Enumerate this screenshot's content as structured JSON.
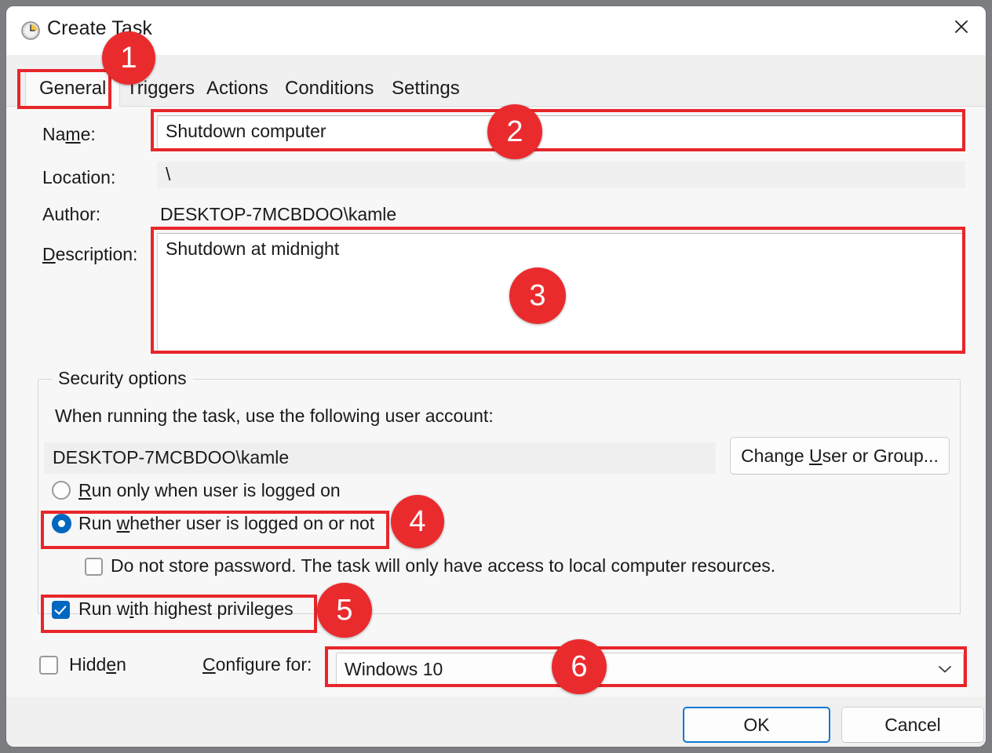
{
  "window": {
    "title": "Create Task",
    "app_icon": "clock-schedule-icon",
    "close_label": "✕"
  },
  "tabs": [
    {
      "label": "General",
      "active": true
    },
    {
      "label": "Triggers",
      "active": false
    },
    {
      "label": "Actions",
      "active": false
    },
    {
      "label": "Conditions",
      "active": false
    },
    {
      "label": "Settings",
      "active": false
    }
  ],
  "general": {
    "name_label_pre": "Na",
    "name_label_key": "m",
    "name_label_post": "e:",
    "name_value": "Shutdown computer",
    "location_label": "Location:",
    "location_value": "\\",
    "author_label": "Author:",
    "author_value": "DESKTOP-7MCBDOO\\kamle",
    "description_label_key": "D",
    "description_label_post": "escription:",
    "description_value": "Shutdown at midnight"
  },
  "security": {
    "legend": "Security options",
    "account_prompt": "When running the task, use the following user account:",
    "account_value": "DESKTOP-7MCBDOO\\kamle",
    "change_user_pre": "Change ",
    "change_user_key": "U",
    "change_user_post": "ser or Group...",
    "radio_logged_on": {
      "key": "R",
      "post": "un only when user is logged on",
      "checked": false
    },
    "radio_whether": {
      "pre": "Run ",
      "key": "w",
      "post": "hether user is logged on or not",
      "checked": true
    },
    "checkbox_no_password": {
      "label": "Do not store password.  The task will only have access to local computer resources.",
      "checked": false
    },
    "checkbox_highest": {
      "pre": "Run w",
      "key": "i",
      "post": "th highest privileges",
      "checked": true
    }
  },
  "bottom": {
    "hidden_pre": "Hidd",
    "hidden_key": "e",
    "hidden_post": "n",
    "hidden_checked": false,
    "configure_key": "C",
    "configure_post": "onfigure for:",
    "configure_value": "Windows 10",
    "configure_arrow": "chevron-down-icon"
  },
  "footer": {
    "ok_label": "OK",
    "cancel_label": "Cancel"
  },
  "annotations": {
    "badges": [
      {
        "number": "1"
      },
      {
        "number": "2"
      },
      {
        "number": "3"
      },
      {
        "number": "4"
      },
      {
        "number": "5"
      },
      {
        "number": "6"
      }
    ],
    "color": "#ea2b2e"
  }
}
